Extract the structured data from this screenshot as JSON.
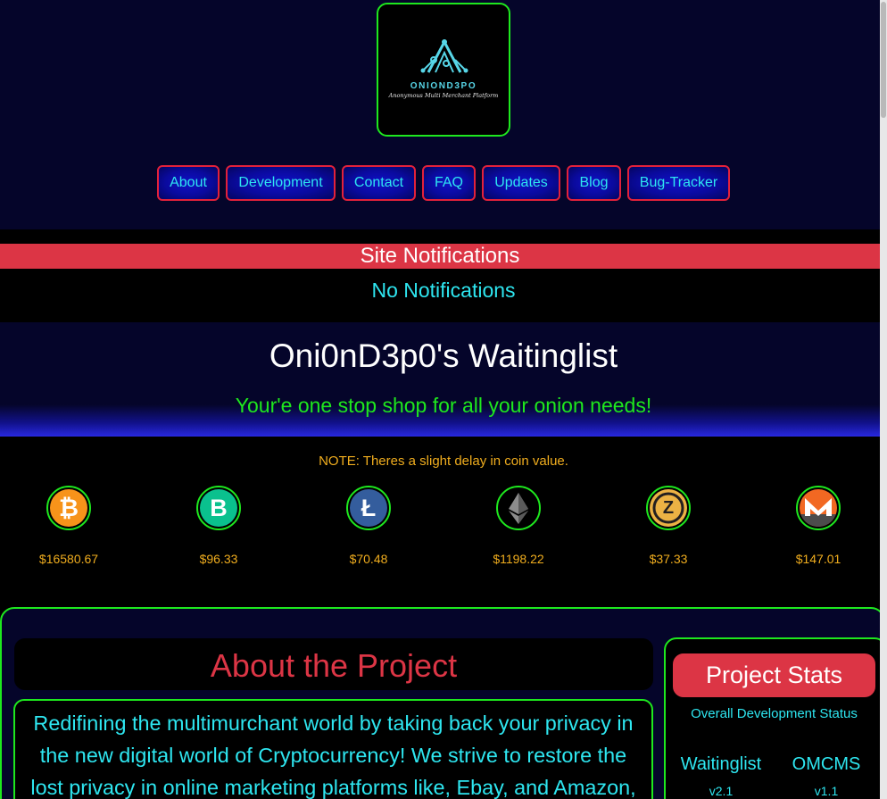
{
  "logo": {
    "brand": "ONIOND3PO",
    "tagline": "Anonymous Multi Merchant Platform"
  },
  "nav": [
    "About",
    "Development",
    "Contact",
    "FAQ",
    "Updates",
    "Blog",
    "Bug-Tracker"
  ],
  "notifications": {
    "title": "Site Notifications",
    "message": "No Notifications"
  },
  "hero": {
    "title": "Oni0nD3p0's Waitinglist",
    "subtitle": "Your'e one stop shop for all your onion needs!"
  },
  "coins": {
    "note": "NOTE: Theres a slight delay in coin value.",
    "items": [
      {
        "icon": "bitcoin-icon",
        "symbol": "₿",
        "color": "#f7931a",
        "price": "$16580.67"
      },
      {
        "icon": "bitcoin-cash-icon",
        "symbol": "B",
        "color": "#0ac18e",
        "price": "$96.33"
      },
      {
        "icon": "litecoin-icon",
        "symbol": "Ł",
        "color": "#345d9d",
        "price": "$70.48"
      },
      {
        "icon": "ethereum-icon",
        "symbol": "",
        "color": "#000000",
        "price": "$1198.22"
      },
      {
        "icon": "zcash-icon",
        "symbol": "Z",
        "color": "#ecb244",
        "price": "$37.33"
      },
      {
        "icon": "monero-icon",
        "symbol": "",
        "color": "#f26822",
        "price": "$147.01"
      }
    ]
  },
  "about": {
    "title": "About the Project",
    "text": "Redifining the multimurchant world by taking back your privacy in the new digital world of Cryptocurrency! We strive to restore the lost privacy in online marketing platforms like, Ebay, and Amazon,"
  },
  "stats": {
    "title": "Project Stats",
    "subtitle": "Overall Development Status",
    "projects": [
      {
        "name": "Waitinglist",
        "version": "v2.1"
      },
      {
        "name": "OMCMS",
        "version": "v1.1"
      }
    ]
  }
}
